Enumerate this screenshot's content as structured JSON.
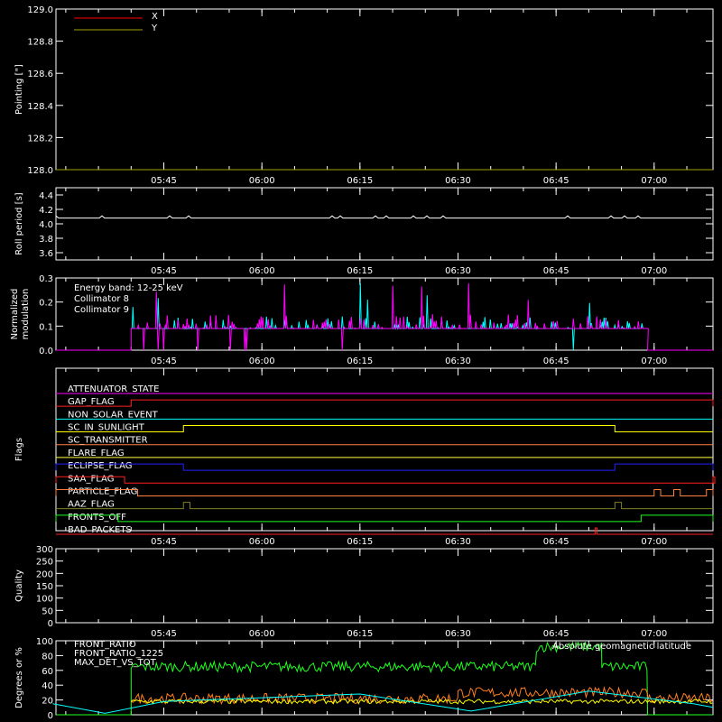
{
  "time_ticks": [
    "05:45",
    "06:00",
    "06:15",
    "06:30",
    "06:45",
    "07:00"
  ],
  "chart_data": [
    {
      "type": "line",
      "ylabel": "Pointing [\"]",
      "ylim": [
        128.0,
        129.0
      ],
      "yticks": [
        "128.0",
        "128.2",
        "128.4",
        "128.6",
        "128.8",
        "129.0"
      ],
      "legend": [
        {
          "name": "X",
          "color": "#ff0000"
        },
        {
          "name": "Y",
          "color": "#a0a000"
        }
      ],
      "series": [
        {
          "name": "X",
          "color": "#ff0000",
          "value": 128.0
        },
        {
          "name": "Y",
          "color": "#a0a000",
          "value": 128.0
        }
      ]
    },
    {
      "type": "line",
      "ylabel": "Roll period [s]",
      "ylim": [
        3.5,
        4.5
      ],
      "yticks": [
        "3.6",
        "3.8",
        "4.0",
        "4.2",
        "4.4"
      ],
      "series": [
        {
          "name": "",
          "color": "#ffffff",
          "value": 4.08
        }
      ]
    },
    {
      "type": "line",
      "ylabel": "Normalized modulation",
      "ylim": [
        0.0,
        0.3
      ],
      "yticks": [
        "0.0",
        "0.1",
        "0.2",
        "0.3"
      ],
      "annotation": "Energy band: 12-25 keV",
      "legend": [
        {
          "name": "Collimator 8",
          "color": "#00ffff"
        },
        {
          "name": "Collimator 9",
          "color": "#ff00ff"
        }
      ],
      "active_range": [
        "05:40",
        "06:59"
      ],
      "baseline": 0.09
    },
    {
      "type": "line",
      "ylabel": "Flags",
      "flags": [
        {
          "name": "ATTENUATOR_STATE",
          "color": "#ff00ff",
          "state_changes": []
        },
        {
          "name": "GAP_FLAG",
          "color": "#ff2020",
          "state_changes": [
            [
              "05:40",
              "07:09"
            ]
          ]
        },
        {
          "name": "NON_SOLAR_EVENT",
          "color": "#00ffff",
          "state_changes": []
        },
        {
          "name": "SC_IN_SUNLIGHT",
          "color": "#ffff00",
          "state_changes": [
            [
              "05:48",
              "06:54"
            ]
          ]
        },
        {
          "name": "SC_TRANSMITTER",
          "color": "#ff8040",
          "state_changes": []
        },
        {
          "name": "FLARE_FLAG",
          "color": "#ffff40",
          "state_changes": []
        },
        {
          "name": "ECLIPSE_FLAG",
          "color": "#2020ff",
          "state_changes": [
            [
              "05:28",
              "05:48"
            ],
            [
              "06:54",
              "07:09"
            ]
          ]
        },
        {
          "name": "SAA_FLAG",
          "color": "#ff2020",
          "state_changes": [
            [
              "05:28",
              "05:39"
            ],
            [
              "07:09",
              "07:09"
            ]
          ]
        },
        {
          "name": "PARTICLE_FLAG",
          "color": "#ff8040",
          "state_changes": [
            [
              "05:28",
              "05:41"
            ],
            [
              "07:00",
              "07:01"
            ],
            [
              "07:03",
              "07:04"
            ],
            [
              "07:08",
              "07:09"
            ]
          ]
        },
        {
          "name": "AAZ_FLAG",
          "color": "#808020",
          "state_changes": [
            [
              "05:48",
              "05:49"
            ],
            [
              "06:54",
              "06:55"
            ]
          ]
        },
        {
          "name": "FRONTS_OFF",
          "color": "#20ff20",
          "state_changes": [
            [
              "05:28",
              "05:38"
            ],
            [
              "06:58",
              "07:09"
            ]
          ]
        },
        {
          "name": "BAD_PACKETS",
          "color": "#ff2020",
          "state_changes": [
            [
              "06:51",
              "06:51"
            ]
          ]
        }
      ]
    },
    {
      "type": "line",
      "ylabel": "Quality",
      "ylim": [
        0,
        300
      ],
      "yticks": [
        "0",
        "50",
        "100",
        "150",
        "200",
        "250",
        "300"
      ],
      "series": []
    },
    {
      "type": "line",
      "ylabel": "Degrees or %",
      "ylim": [
        0,
        100
      ],
      "yticks": [
        "0",
        "20",
        "40",
        "60",
        "80",
        "100"
      ],
      "legend": [
        {
          "name": "FRONT_RATIO",
          "color": "#ffff00"
        },
        {
          "name": "FRONT_RATIO_1225",
          "color": "#20ff20"
        },
        {
          "name": "MAX_DET_VS_TOT",
          "color": "#ff8020"
        }
      ],
      "legend_right": {
        "name": "Absolute geomagnetic latitude",
        "color": "#00ffff"
      },
      "series": [
        {
          "name": "FRONT_RATIO_1225",
          "color": "#20ff20",
          "segments": [
            [
              "05:40",
              "06:42",
              65
            ],
            [
              "06:42",
              "06:52",
              92
            ],
            [
              "06:52",
              "06:59",
              65
            ]
          ]
        },
        {
          "name": "MAX_DET_VS_TOT",
          "color": "#ff8020",
          "segments": [
            [
              "05:40",
              "06:30",
              22
            ],
            [
              "06:30",
              "06:59",
              30
            ],
            [
              "06:59",
              "07:09",
              22
            ]
          ]
        },
        {
          "name": "FRONT_RATIO",
          "color": "#ffff00",
          "segments": [
            [
              "05:40",
              "07:09",
              18
            ]
          ]
        },
        {
          "name": "Absolute geomagnetic latitude",
          "color": "#00ffff",
          "points": [
            [
              "05:28",
              15
            ],
            [
              "05:36",
              2
            ],
            [
              "05:45",
              18
            ],
            [
              "06:15",
              28
            ],
            [
              "06:32",
              5
            ],
            [
              "06:50",
              32
            ],
            [
              "07:06",
              15
            ],
            [
              "07:09",
              10
            ]
          ]
        }
      ]
    }
  ]
}
